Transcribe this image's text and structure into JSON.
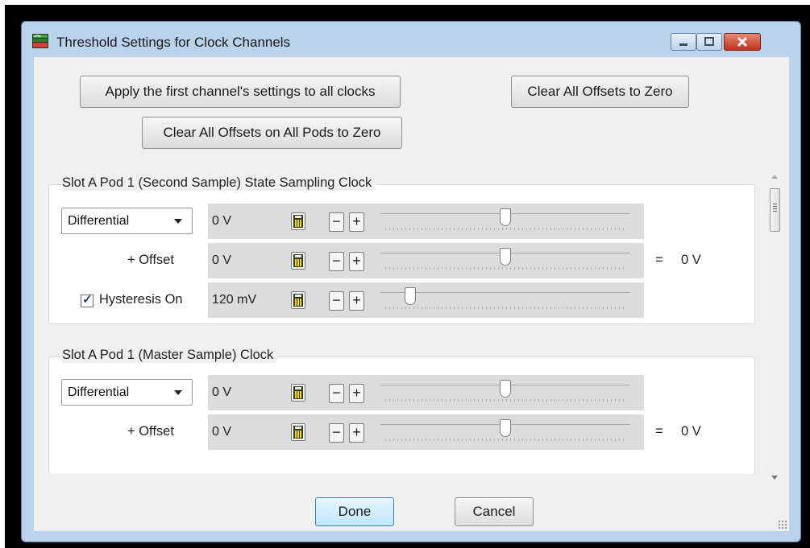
{
  "window": {
    "title": "Threshold Settings for Clock Channels",
    "controls": [
      "minimize",
      "maximize",
      "close"
    ]
  },
  "actions": {
    "apply_first_label": "Apply the first channel's settings to all clocks",
    "clear_offsets_label": "Clear All Offsets to Zero",
    "clear_all_pods_label": "Clear All Offsets on All Pods to Zero"
  },
  "groups": [
    {
      "title": "Slot A Pod 1 (Second Sample) State Sampling Clock",
      "mode": "Differential",
      "threshold": {
        "value": "0 V",
        "slider_fraction": 0.5
      },
      "offset": {
        "label": "+ Offset",
        "value": "0 V",
        "slider_fraction": 0.5,
        "equals": "=",
        "result": "0 V"
      },
      "hysteresis": {
        "label": "Hysteresis On",
        "checked": true,
        "value": "120 mV",
        "slider_fraction": 0.12
      }
    },
    {
      "title": "Slot A Pod 1 (Master Sample) Clock",
      "mode": "Differential",
      "threshold": {
        "value": "0 V",
        "slider_fraction": 0.5
      },
      "offset": {
        "label": "+ Offset",
        "value": "0 V",
        "slider_fraction": 0.5,
        "equals": "=",
        "result": "0 V"
      }
    }
  ],
  "icons": {
    "calculator": "calculator-icon",
    "minus": "−",
    "plus": "+",
    "check": "✓"
  },
  "footer": {
    "done_label": "Done",
    "cancel_label": "Cancel"
  },
  "colors": {
    "window_frame": "#b9d3ec",
    "close_button": "#c1331c",
    "client_bg": "#f0f0f0",
    "control_strip": "#dcdcdc"
  }
}
